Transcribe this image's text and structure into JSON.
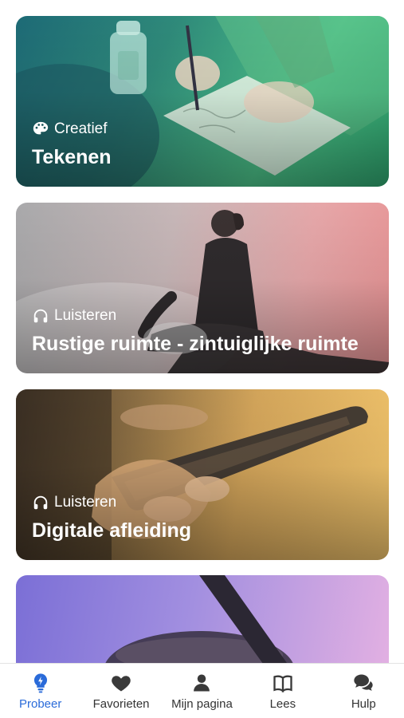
{
  "cards": [
    {
      "category": "Creatief",
      "category_icon": "palette-icon",
      "title": "Tekenen"
    },
    {
      "category": "Luisteren",
      "category_icon": "headphones-icon",
      "title": "Rustige ruimte - zintuiglijke ruimte"
    },
    {
      "category": "Luisteren",
      "category_icon": "headphones-icon",
      "title": "Digitale afleiding"
    }
  ],
  "tabbar": {
    "active": "Probeer",
    "accent_color": "#2a6bd9",
    "items": [
      {
        "label": "Probeer",
        "icon": "lightbulb-bolt-icon"
      },
      {
        "label": "Favorieten",
        "icon": "heart-icon"
      },
      {
        "label": "Mijn pagina",
        "icon": "person-icon"
      },
      {
        "label": "Lees",
        "icon": "book-icon"
      },
      {
        "label": "Hulp",
        "icon": "chat-bubbles-icon"
      }
    ]
  }
}
